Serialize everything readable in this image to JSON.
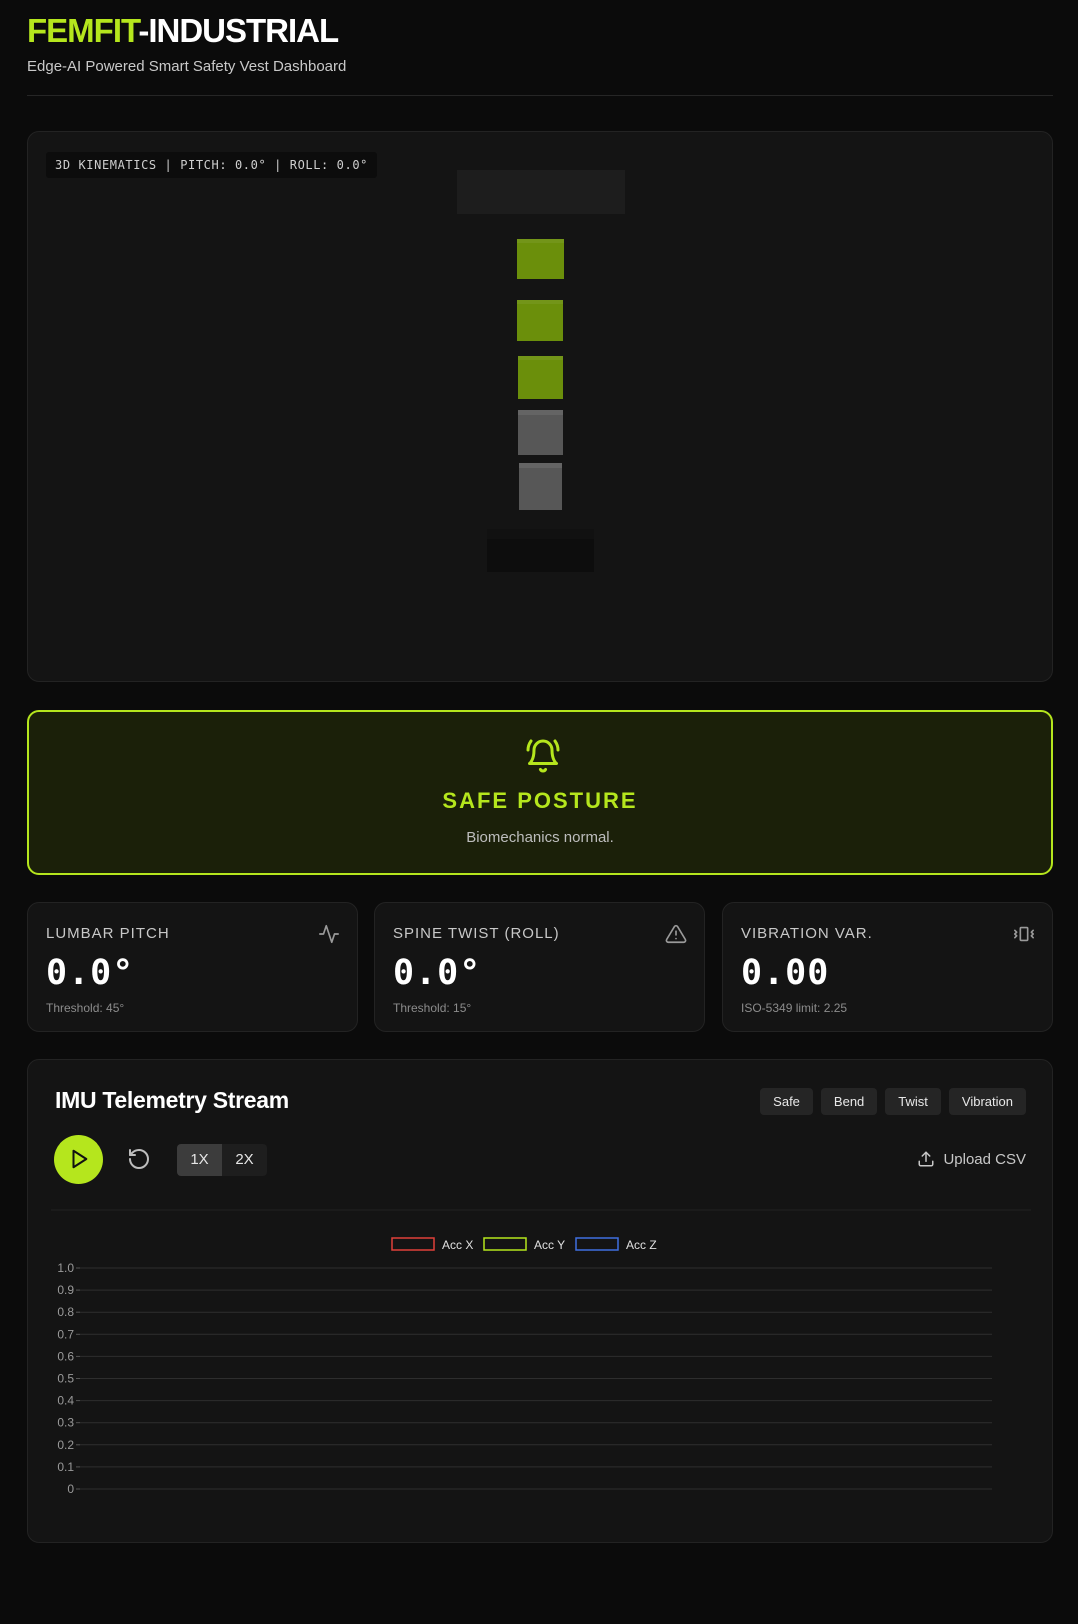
{
  "header": {
    "brand_accent": "FEMFIT",
    "brand_rest": "-INDUSTRIAL",
    "subtitle": "Edge-AI Powered Smart Safety Vest Dashboard"
  },
  "viewer": {
    "label": "3D KINEMATICS | PITCH: 0.0° | ROLL: 0.0°"
  },
  "alert": {
    "icon": "bell-ring-icon",
    "title": "SAFE POSTURE",
    "message": "Biomechanics normal."
  },
  "metrics": [
    {
      "label": "LUMBAR PITCH",
      "value": "0.0°",
      "note": "Threshold: 45°",
      "icon": "activity-icon"
    },
    {
      "label": "SPINE TWIST (ROLL)",
      "value": "0.0°",
      "note": "Threshold: 15°",
      "icon": "warning-triangle-icon"
    },
    {
      "label": "VIBRATION VAR.",
      "value": "0.00",
      "note": "ISO-5349 limit: 2.25",
      "icon": "vibrate-icon"
    }
  ],
  "telemetry": {
    "title": "IMU Telemetry Stream",
    "scenarios": [
      "Safe",
      "Bend",
      "Twist",
      "Vibration"
    ],
    "speeds": [
      "1X",
      "2X"
    ],
    "active_speed": "1X",
    "upload_label": "Upload CSV"
  },
  "colors": {
    "accent": "#b5e61d",
    "acc_x": "#e0403a",
    "acc_y": "#b5e61d",
    "acc_z": "#3f6fe0"
  },
  "chart_data": {
    "type": "line",
    "series": [
      {
        "name": "Acc X",
        "values": []
      },
      {
        "name": "Acc Y",
        "values": []
      },
      {
        "name": "Acc Z",
        "values": []
      }
    ],
    "ylim": [
      0,
      1
    ],
    "yticks": [
      "0",
      "0.1",
      "0.2",
      "0.3",
      "0.4",
      "0.5",
      "0.6",
      "0.7",
      "0.8",
      "0.9",
      "1.0"
    ],
    "grid": true,
    "legend": "top-center"
  }
}
